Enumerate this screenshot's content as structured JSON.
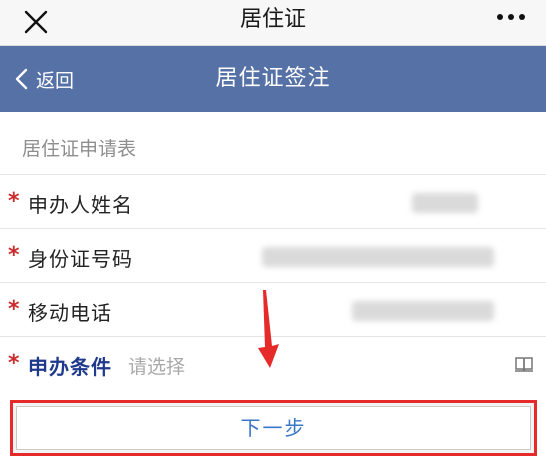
{
  "wechat_bar": {
    "title": "居住证",
    "close_icon": "close-icon",
    "more_icon": "more-dots-icon"
  },
  "header": {
    "back_label": "返回",
    "title": "居住证签注",
    "color": "#5671a6"
  },
  "form": {
    "heading": "居住证申请表",
    "required_mark": "*",
    "fields": [
      {
        "label": "申办人姓名",
        "value": ""
      },
      {
        "label": "身份证号码",
        "value": ""
      },
      {
        "label": "移动电话",
        "value": ""
      },
      {
        "label": "申办条件",
        "placeholder": "请选择",
        "value": ""
      }
    ]
  },
  "next_button": {
    "label": "下一步",
    "highlight_color": "#e62a2a"
  }
}
